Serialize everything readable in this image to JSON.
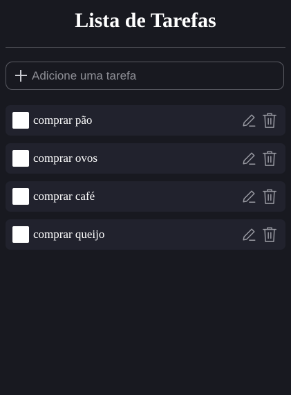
{
  "header": {
    "title": "Lista de Tarefas"
  },
  "add_task": {
    "placeholder": "Adicione uma tarefa",
    "value": "",
    "icon": "plus-icon"
  },
  "tasks": [
    {
      "label": "comprar pão",
      "checked": false
    },
    {
      "label": "comprar ovos",
      "checked": false
    },
    {
      "label": "comprar café",
      "checked": false
    },
    {
      "label": "comprar queijo",
      "checked": false
    }
  ],
  "icons": {
    "edit": "pencil-icon",
    "delete": "trash-icon"
  },
  "colors": {
    "background": "#181920",
    "task_background": "#21222d",
    "icon": "#9a9ba3",
    "text": "#ffffff"
  }
}
